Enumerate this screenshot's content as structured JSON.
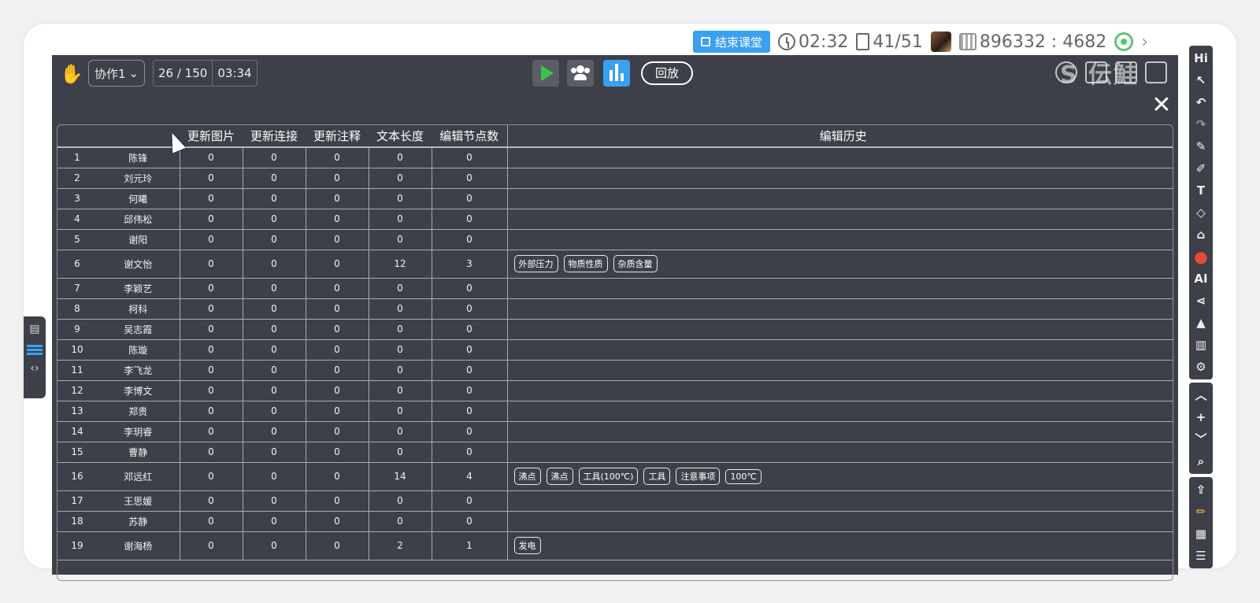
{
  "status": {
    "end_class_label": "结束课堂",
    "timer": "02:32",
    "pages": "41/51",
    "room_code": "896332 : 4682",
    "next": "›"
  },
  "toolbar": {
    "group_select": "协作1",
    "progress": "26 / 150",
    "elapsed": "03:34",
    "replay_label": "回放",
    "watermark": "S 伝鮭",
    "close": "✕"
  },
  "table": {
    "headers": [
      "",
      "",
      "更新图片",
      "更新连接",
      "更新注释",
      "文本长度",
      "编辑节点数",
      "编辑历史"
    ],
    "rows": [
      {
        "no": "1",
        "name": "陈锋",
        "img": "0",
        "link": "0",
        "note": "0",
        "len": "0",
        "nodes": "0",
        "history": []
      },
      {
        "no": "2",
        "name": "刘元玲",
        "img": "0",
        "link": "0",
        "note": "0",
        "len": "0",
        "nodes": "0",
        "history": []
      },
      {
        "no": "3",
        "name": "何曦",
        "img": "0",
        "link": "0",
        "note": "0",
        "len": "0",
        "nodes": "0",
        "history": []
      },
      {
        "no": "4",
        "name": "邱伟松",
        "img": "0",
        "link": "0",
        "note": "0",
        "len": "0",
        "nodes": "0",
        "history": []
      },
      {
        "no": "5",
        "name": "谢阳",
        "img": "0",
        "link": "0",
        "note": "0",
        "len": "0",
        "nodes": "0",
        "history": []
      },
      {
        "no": "6",
        "name": "谢文怡",
        "img": "0",
        "link": "0",
        "note": "0",
        "len": "12",
        "nodes": "3",
        "history": [
          "外部压力",
          "物质性质",
          "杂质含量"
        ]
      },
      {
        "no": "7",
        "name": "李颖艺",
        "img": "0",
        "link": "0",
        "note": "0",
        "len": "0",
        "nodes": "0",
        "history": []
      },
      {
        "no": "8",
        "name": "柯科",
        "img": "0",
        "link": "0",
        "note": "0",
        "len": "0",
        "nodes": "0",
        "history": []
      },
      {
        "no": "9",
        "name": "吴志霞",
        "img": "0",
        "link": "0",
        "note": "0",
        "len": "0",
        "nodes": "0",
        "history": []
      },
      {
        "no": "10",
        "name": "陈璇",
        "img": "0",
        "link": "0",
        "note": "0",
        "len": "0",
        "nodes": "0",
        "history": []
      },
      {
        "no": "11",
        "name": "李飞龙",
        "img": "0",
        "link": "0",
        "note": "0",
        "len": "0",
        "nodes": "0",
        "history": []
      },
      {
        "no": "12",
        "name": "李博文",
        "img": "0",
        "link": "0",
        "note": "0",
        "len": "0",
        "nodes": "0",
        "history": []
      },
      {
        "no": "13",
        "name": "郑贵",
        "img": "0",
        "link": "0",
        "note": "0",
        "len": "0",
        "nodes": "0",
        "history": []
      },
      {
        "no": "14",
        "name": "李玥睿",
        "img": "0",
        "link": "0",
        "note": "0",
        "len": "0",
        "nodes": "0",
        "history": []
      },
      {
        "no": "15",
        "name": "曹静",
        "img": "0",
        "link": "0",
        "note": "0",
        "len": "0",
        "nodes": "0",
        "history": []
      },
      {
        "no": "16",
        "name": "邓远红",
        "img": "0",
        "link": "0",
        "note": "0",
        "len": "14",
        "nodes": "4",
        "history": [
          "沸点",
          "沸点",
          "工具(100℃)",
          "工具",
          "注意事项",
          "100℃"
        ]
      },
      {
        "no": "17",
        "name": "王思媛",
        "img": "0",
        "link": "0",
        "note": "0",
        "len": "0",
        "nodes": "0",
        "history": []
      },
      {
        "no": "18",
        "name": "苏静",
        "img": "0",
        "link": "0",
        "note": "0",
        "len": "0",
        "nodes": "0",
        "history": []
      },
      {
        "no": "19",
        "name": "谢海杨",
        "img": "0",
        "link": "0",
        "note": "0",
        "len": "2",
        "nodes": "1",
        "history": [
          "发电"
        ]
      }
    ]
  },
  "right_toolbar": {
    "hi_label": "Hi",
    "ai_label": "AI",
    "items": [
      "pointer-icon",
      "undo-icon",
      "redo-icon",
      "pen-icon",
      "brush-icon",
      "text-icon",
      "eraser-icon",
      "clear-icon",
      "color-palette-icon",
      "ai-icon",
      "share-icon",
      "stamp-icon",
      "trash-icon",
      "settings-icon"
    ],
    "nav": [
      "chevron-up-icon",
      "plus-icon",
      "chevron-down-icon",
      "search-icon"
    ],
    "bottom": [
      "upload-icon",
      "pencil-icon",
      "grid-icon",
      "list-icon"
    ]
  },
  "colors": {
    "panel": "#3d4048",
    "accent": "#3aa0f0",
    "play": "#3bc34a"
  }
}
